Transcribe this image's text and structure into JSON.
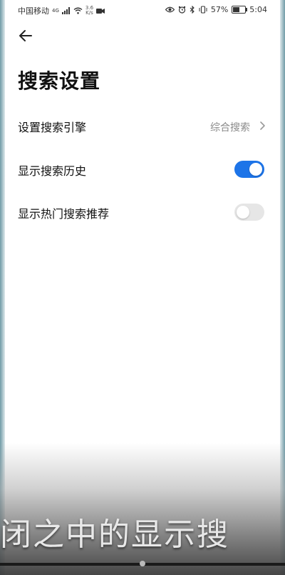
{
  "statusbar": {
    "carrier": "中国移动",
    "network": "4G",
    "speed_value": "3.6",
    "speed_unit": "K/s",
    "battery_percent": "57%",
    "battery_level": 0.57,
    "time": "5:04"
  },
  "header": {
    "title": "搜索设置"
  },
  "settings": {
    "search_engine": {
      "label": "设置搜索引擎",
      "value": "综合搜索"
    },
    "show_history": {
      "label": "显示搜索历史",
      "enabled": true
    },
    "show_hot": {
      "label": "显示热门搜索推荐",
      "enabled": false
    }
  },
  "overlay": {
    "caption": "闭之中的显示搜"
  },
  "colors": {
    "accent": "#1d74e8",
    "toggle_off": "#e6e6e6",
    "secondary_text": "#8a8a8a"
  },
  "icons": {
    "back": "arrow-left-icon",
    "chevron": "chevron-right-icon"
  }
}
